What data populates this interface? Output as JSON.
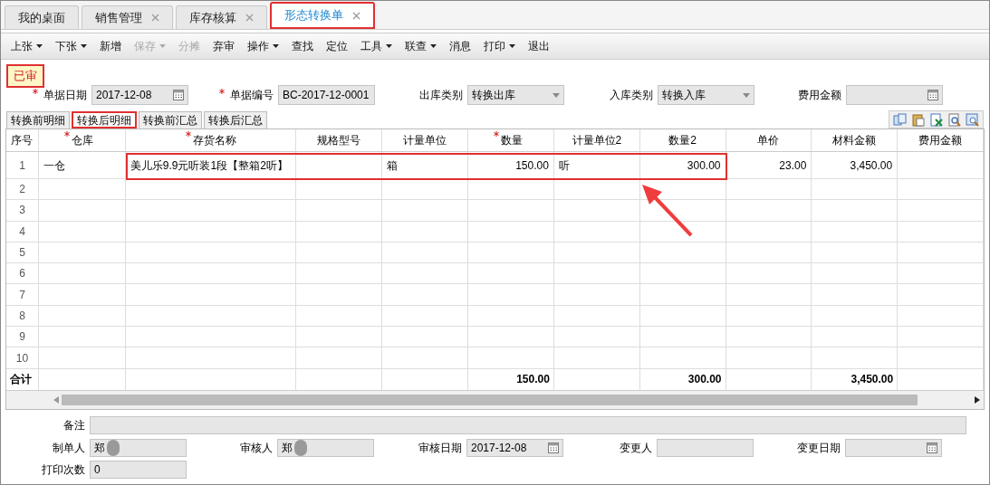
{
  "tabs": [
    {
      "label": "我的桌面",
      "closable": false,
      "selected": false,
      "highlighted": false
    },
    {
      "label": "销售管理",
      "closable": true,
      "selected": false,
      "highlighted": false
    },
    {
      "label": "库存核算",
      "closable": true,
      "selected": false,
      "highlighted": false
    },
    {
      "label": "形态转换单",
      "closable": true,
      "selected": true,
      "highlighted": true
    }
  ],
  "toolbar": [
    {
      "label": "上张",
      "dropdown": true,
      "disabled": false
    },
    {
      "label": "下张",
      "dropdown": true,
      "disabled": false
    },
    {
      "label": "新增",
      "dropdown": false,
      "disabled": false
    },
    {
      "label": "保存",
      "dropdown": true,
      "disabled": true
    },
    {
      "label": "分摊",
      "dropdown": false,
      "disabled": true
    },
    {
      "label": "弃审",
      "dropdown": false,
      "disabled": false
    },
    {
      "label": "操作",
      "dropdown": true,
      "disabled": false
    },
    {
      "label": "查找",
      "dropdown": false,
      "disabled": false
    },
    {
      "label": "定位",
      "dropdown": false,
      "disabled": false
    },
    {
      "label": "工具",
      "dropdown": true,
      "disabled": false
    },
    {
      "label": "联查",
      "dropdown": true,
      "disabled": false
    },
    {
      "label": "消息",
      "dropdown": false,
      "disabled": false
    },
    {
      "label": "打印",
      "dropdown": true,
      "disabled": false
    },
    {
      "label": "退出",
      "dropdown": false,
      "disabled": false
    }
  ],
  "status": {
    "text": "已审",
    "highlighted": true
  },
  "header_fields": [
    {
      "label": "单据日期",
      "required": true,
      "value": "2017-12-08",
      "kind": "date"
    },
    {
      "label": "单据编号",
      "required": true,
      "value": "BC-2017-12-0001",
      "kind": "text"
    },
    {
      "label": "出库类别",
      "required": false,
      "value": "转换出库",
      "kind": "select"
    },
    {
      "label": "入库类别",
      "required": false,
      "value": "转换入库",
      "kind": "select"
    },
    {
      "label": "费用金额",
      "required": false,
      "kind": "date"
    }
  ],
  "detail_tabs": [
    {
      "label": "转换前明细",
      "selected": false,
      "highlighted": false
    },
    {
      "label": "转换后明细",
      "selected": true,
      "highlighted": true
    },
    {
      "label": "转换前汇总",
      "selected": false,
      "highlighted": false
    },
    {
      "label": "转换后汇总",
      "selected": false,
      "highlighted": false
    }
  ],
  "table": {
    "columns": [
      {
        "label": "序号",
        "required": false
      },
      {
        "label": "仓库",
        "required": true
      },
      {
        "label": "存货名称",
        "required": true
      },
      {
        "label": "规格型号",
        "required": false
      },
      {
        "label": "计量单位",
        "required": false
      },
      {
        "label": "数量",
        "required": true
      },
      {
        "label": "计量单位2",
        "required": false
      },
      {
        "label": "数量2",
        "required": false
      },
      {
        "label": "单价",
        "required": false
      },
      {
        "label": "材料金额",
        "required": false
      },
      {
        "label": "费用金额",
        "required": false
      }
    ],
    "rows": [
      {
        "number": "1",
        "warehouse": "一仓",
        "item_name": "美儿乐9.9元听装1段【整箱2听】",
        "unit": "箱",
        "quantity": "150.00",
        "unit2": "听",
        "quantity2": "300.00",
        "unit_price": "23.00",
        "material_amount": "3,450.00",
        "highlighted": true
      },
      {
        "number": "2",
        "highlighted": false
      },
      {
        "number": "3",
        "highlighted": false
      },
      {
        "number": "4",
        "highlighted": false
      },
      {
        "number": "5",
        "highlighted": false
      },
      {
        "number": "6",
        "highlighted": false
      },
      {
        "number": "7",
        "highlighted": false
      },
      {
        "number": "8",
        "highlighted": false
      },
      {
        "number": "9",
        "highlighted": false
      },
      {
        "number": "10",
        "highlighted": false
      }
    ],
    "total_row": {
      "label": "合计",
      "quantity": "150.00",
      "quantity2": "300.00",
      "material_amount": "3,450.00"
    }
  },
  "footer_fields": [
    {
      "label": "备注",
      "kind": "wide"
    },
    {
      "label": "制单人",
      "value": "郑",
      "kind": "text",
      "redacted": true
    },
    {
      "label": "审核人",
      "value": "郑",
      "kind": "text",
      "redacted": true
    },
    {
      "label": "审核日期",
      "value": "2017-12-08",
      "kind": "date"
    },
    {
      "label": "变更人",
      "kind": "text"
    },
    {
      "label": "变更日期",
      "kind": "date"
    },
    {
      "label": "打印次数",
      "value": "0",
      "kind": "text"
    }
  ]
}
